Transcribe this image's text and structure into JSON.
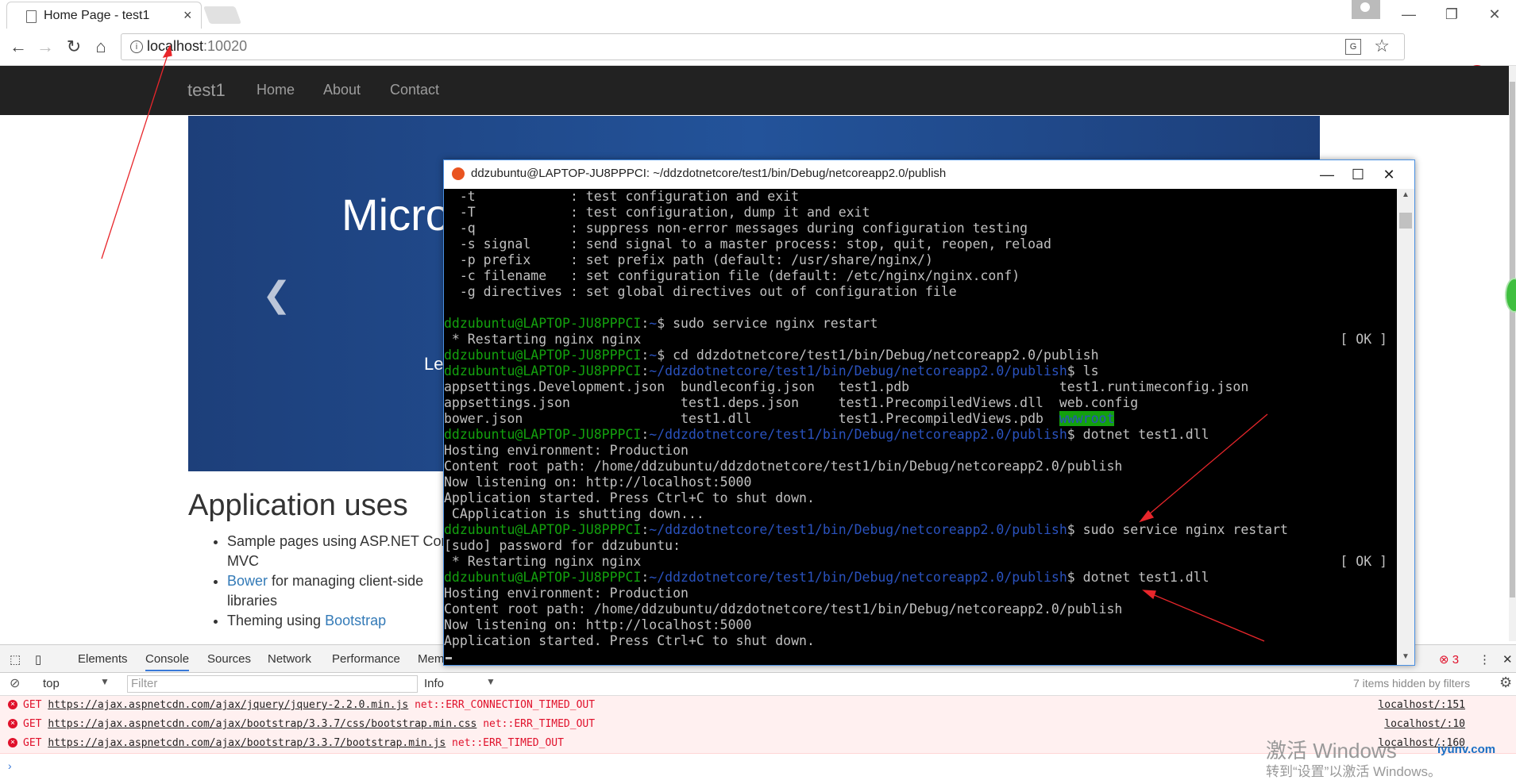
{
  "browser": {
    "tab_title": "Home Page - test1",
    "tab_close": "×",
    "url_host": "localhost",
    "url_port": ":10020",
    "window_controls": {
      "minimize": "—",
      "restore": "❐",
      "close": "✕"
    }
  },
  "site": {
    "brand": "test1",
    "nav": [
      "Home",
      "About",
      "Contact"
    ],
    "carousel_title": "Micro",
    "carousel_caption": "Le",
    "section_heading": "Application uses",
    "list": {
      "item1": "Sample pages using ASP.NET Core MVC",
      "item2_link": "Bower",
      "item2_text": " for managing client-side libraries",
      "item3_text": "Theming using ",
      "item3_link": "Bootstrap"
    }
  },
  "terminal": {
    "title": "ddzubuntu@LAPTOP-JU8PPPCI: ~/ddzdotnetcore/test1/bin/Debug/netcoreapp2.0/publish",
    "prompt_user": "ddzubuntu@LAPTOP-JU8PPPCI",
    "publish_path": "~/ddzdotnetcore/test1/bin/Debug/netcoreapp2.0/publish",
    "lines": [
      "  -t            : test configuration and exit",
      "  -T            : test configuration, dump it and exit",
      "  -q            : suppress non-error messages during configuration testing",
      "  -s signal     : send signal to a master process: stop, quit, reopen, reload",
      "  -p prefix     : set prefix path (default: /usr/share/nginx/)",
      "  -c filename   : set configuration file (default: /etc/nginx/nginx.conf)",
      "  -g directives : set global directives out of configuration file"
    ],
    "cmd1": "$ sudo service nginx restart",
    "restarting": " * Restarting nginx nginx",
    "ok": "[ OK ]",
    "cmd2": "$ cd ddzdotnetcore/test1/bin/Debug/netcoreapp2.0/publish",
    "cmd3": "$ ls",
    "ls_row1": "appsettings.Development.json  bundleconfig.json   test1.pdb                   test1.runtimeconfig.json",
    "ls_row2": "appsettings.json              test1.deps.json     test1.PrecompiledViews.dll  web.config",
    "ls_row3_a": "bower.json                    test1.dll           test1.PrecompiledViews.pdb  ",
    "ls_row3_b": "wwwroot",
    "cmd4": "$ dotnet test1.dll",
    "host_env": "Hosting environment: Production",
    "content_root": "Content root path: /home/ddzubuntu/ddzdotnetcore/test1/bin/Debug/netcoreapp2.0/publish",
    "listening": "Now listening on: http://localhost:5000",
    "started": "Application started. Press Ctrl+C to shut down.",
    "shutting": " CApplication is shutting down...",
    "cmd5": "$ sudo service nginx restart",
    "sudo_pw": "[sudo] password for ddzubuntu:",
    "cmd6": "$ dotnet test1.dll",
    "colon": ":"
  },
  "devtools": {
    "tabs": [
      "Elements",
      "Console",
      "Sources",
      "Network",
      "Performance",
      "Mem"
    ],
    "active_tab": "Console",
    "context": "top",
    "filter_placeholder": "Filter",
    "level": "Info",
    "hidden": "7 items hidden by filters",
    "error_count": "3",
    "errors": [
      {
        "method": "GET",
        "url": "https://ajax.aspnetcdn.com/ajax/jquery/jquery-2.2.0.min.js",
        "err": "net::ERR_CONNECTION_TIMED_OUT",
        "src": "localhost/:151"
      },
      {
        "method": "GET",
        "url": "https://ajax.aspnetcdn.com/ajax/bootstrap/3.3.7/css/bootstrap.min.css",
        "err": "net::ERR_TIMED_OUT",
        "src": "localhost/:10"
      },
      {
        "method": "GET",
        "url": "https://ajax.aspnetcdn.com/ajax/bootstrap/3.3.7/bootstrap.min.js",
        "err": "net::ERR_TIMED_OUT",
        "src": "localhost/:160"
      }
    ]
  },
  "overlay": {
    "watermark1": "激活 Windows",
    "watermark2": "转到“设置”以激活 Windows。",
    "site_logo": "iyunv.com"
  },
  "colors": {
    "prompt_green": "#13a10e",
    "path_blue": "#2a52be",
    "navbar": "#222222",
    "carousel": "#23539a",
    "error_red": "#e0112b"
  }
}
